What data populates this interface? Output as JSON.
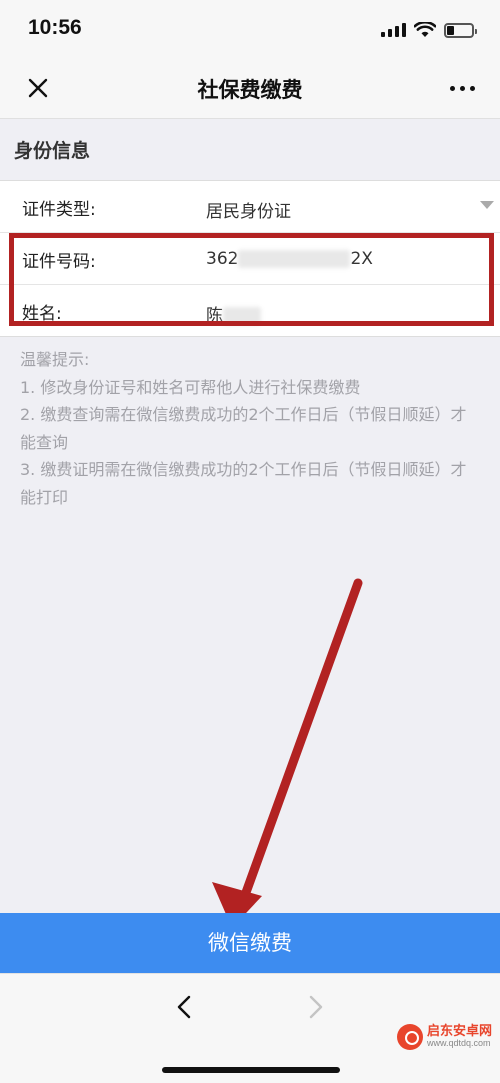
{
  "status_bar": {
    "time": "10:56"
  },
  "nav": {
    "title": "社保费缴费"
  },
  "section": {
    "title": "身份信息"
  },
  "form": {
    "id_type": {
      "label": "证件类型:",
      "value": "居民身份证"
    },
    "id_number": {
      "label": "证件号码:",
      "prefix": "362",
      "suffix": "2X"
    },
    "name": {
      "label": "姓名:",
      "prefix": "陈"
    }
  },
  "tips": {
    "heading": "温馨提示:",
    "items": [
      "1. 修改身份证号和姓名可帮他人进行社保费缴费",
      "2. 缴费查询需在微信缴费成功的2个工作日后（节假日顺延）才能查询",
      "3. 缴费证明需在微信缴费成功的2个工作日后（节假日顺延）才能打印"
    ]
  },
  "pay_button": {
    "label": "微信缴费"
  },
  "watermark": {
    "name": "启东安卓网",
    "url": "www.qdtdq.com"
  },
  "colors": {
    "accent": "#3d8cf0",
    "highlight": "#b22222",
    "tip_text": "#a2a2a8"
  }
}
